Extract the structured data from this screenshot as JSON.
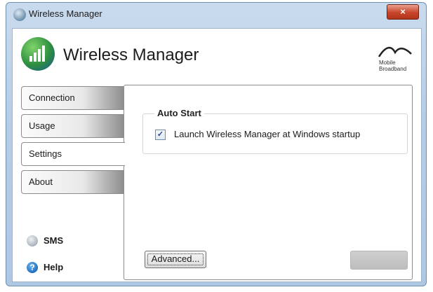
{
  "window": {
    "title": "Wireless Manager",
    "close_glyph": "×"
  },
  "header": {
    "app_title": "Wireless Manager",
    "brand_text_line1": "Mobile",
    "brand_text_line2": "Broadband"
  },
  "tabs": [
    {
      "label": "Connection",
      "active": false
    },
    {
      "label": "Usage",
      "active": false
    },
    {
      "label": "Settings",
      "active": true
    },
    {
      "label": "About",
      "active": false
    }
  ],
  "settings": {
    "group_title": "Auto Start",
    "checkbox_label": "Launch Wireless Manager at Windows startup",
    "checkbox_checked": true,
    "check_glyph": "✓",
    "advanced_button": "Advanced..."
  },
  "side_links": {
    "sms": "SMS",
    "help": "Help",
    "help_glyph": "?"
  },
  "icons": {
    "app": "signal-bars-icon",
    "sms": "sms-icon",
    "help": "help-icon",
    "brand": "mobile-broadband-logo"
  }
}
